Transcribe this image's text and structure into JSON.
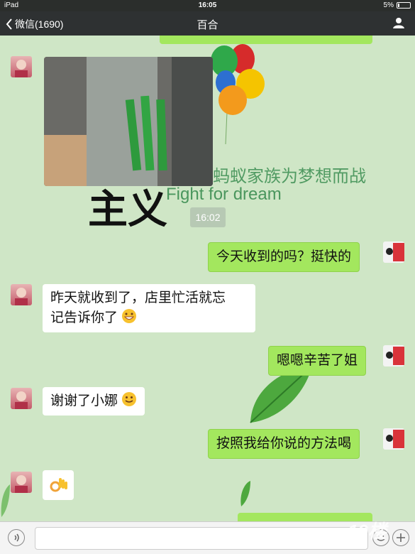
{
  "status": {
    "carrier": "iPad",
    "time": "16:05",
    "battery": "5%"
  },
  "nav": {
    "back_label": "微信(1690)",
    "title": "百合"
  },
  "background": {
    "slogan_cn": "蚂蚁家族为梦想而战",
    "slogan_en": "Fight for dream",
    "big_glyph": "主义"
  },
  "timestamp": "16:02",
  "messages": [
    {
      "side": "out",
      "text": "今天收到的吗？挺快的"
    },
    {
      "side": "in",
      "text_line1": "昨天就收到了，店里忙活就忘",
      "text_line2": "记告诉你了",
      "emoji": "grin-emoji"
    },
    {
      "side": "out",
      "text": "嗯嗯辛苦了姐"
    },
    {
      "side": "in",
      "text": "谢谢了小娜",
      "emoji": "smile-emoji"
    },
    {
      "side": "out",
      "text": "按照我给你说的方法喝"
    },
    {
      "side": "in",
      "emoji": "ok-hand-emoji"
    }
  ],
  "input": {
    "placeholder": ""
  },
  "watermark": "19楼",
  "colors": {
    "chat_bg": "#cfe6c6",
    "outgoing_bubble": "#a3e75e",
    "incoming_bubble": "#ffffff",
    "navbar": "#2e3132"
  }
}
